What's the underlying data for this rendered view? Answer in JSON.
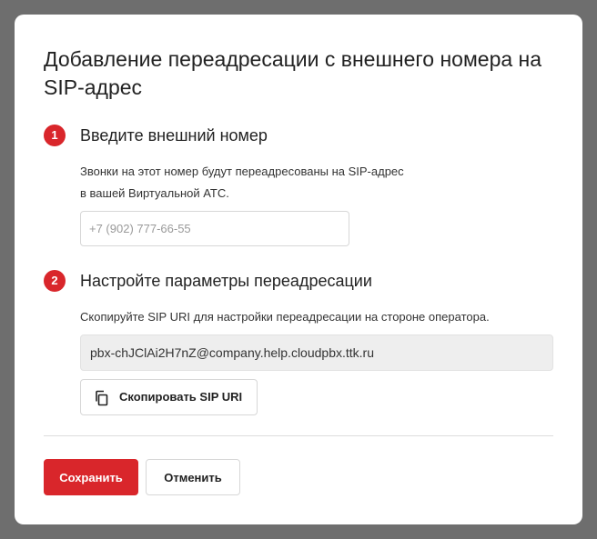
{
  "dialog": {
    "title": "Добавление переадресации с внешнего номера на SIP-адрес"
  },
  "step1": {
    "number": "1",
    "title": "Введите внешний номер",
    "description_line1": "Звонки на этот номер будут переадресованы на SIP-адрес",
    "description_line2": "в вашей Виртуальной АТС.",
    "phone_placeholder": "+7 (902) 777-66-55",
    "phone_value": ""
  },
  "step2": {
    "number": "2",
    "title": "Настройте параметры переадресации",
    "description": "Скопируйте SIP URI для настройки переадресации на стороне оператора.",
    "sip_uri": "pbx-chJClAi2H7nZ@company.help.cloudpbx.ttk.ru",
    "copy_button_label": "Скопировать SIP URI",
    "copy_icon": "copy-icon"
  },
  "actions": {
    "save_label": "Сохранить",
    "cancel_label": "Отменить"
  },
  "colors": {
    "accent": "#d9262b",
    "overlay": "#6e6e6e",
    "field_background": "#eeeeee"
  }
}
